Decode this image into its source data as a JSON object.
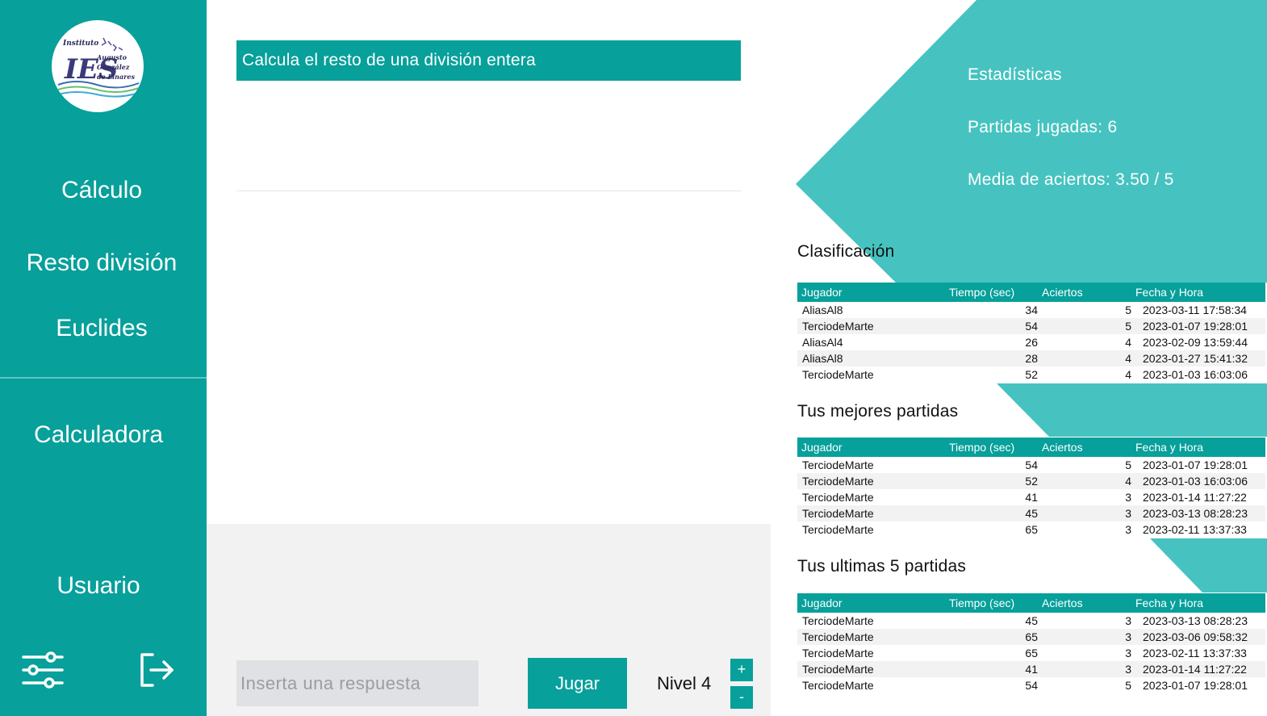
{
  "sidebar": {
    "logo_text": "Instituto IES Augusto González de Linares",
    "items": [
      {
        "label": "Cálculo"
      },
      {
        "label": "Resto división"
      },
      {
        "label": "Euclides"
      },
      {
        "label": "Calculadora"
      },
      {
        "label": "Usuario"
      }
    ],
    "icons": [
      "settings-sliders-icon",
      "logout-icon"
    ]
  },
  "main": {
    "question_title": "Calcula el resto de una división entera",
    "answer_placeholder": "Inserta una respuesta",
    "answer_value": "",
    "play_label": "Jugar",
    "level_label": "Nivel 4",
    "level_plus": "+",
    "level_minus": "-"
  },
  "stats": {
    "title": "Estadísticas",
    "games_played": "Partidas jugadas: 6",
    "average_hits": "Media de aciertos: 3.50 / 5"
  },
  "colors": {
    "primary": "#07a09b",
    "decor": "#46c3c0",
    "divider": "#5cc6c2",
    "panel_grey": "#f2f2f2",
    "input_grey": "#dfe1e4"
  },
  "tables": [
    {
      "title": "Clasificación",
      "headers": [
        "Jugador",
        "Tiempo (sec)",
        "Aciertos",
        "Fecha y Hora"
      ],
      "rows": [
        [
          "AliasAl8",
          "34",
          "5",
          "2023-03-11 17:58:34"
        ],
        [
          "TerciodeMarte",
          "54",
          "5",
          "2023-01-07 19:28:01"
        ],
        [
          "AliasAl4",
          "26",
          "4",
          "2023-02-09 13:59:44"
        ],
        [
          "AliasAl8",
          "28",
          "4",
          "2023-01-27 15:41:32"
        ],
        [
          "TerciodeMarte",
          "52",
          "4",
          "2023-01-03 16:03:06"
        ]
      ]
    },
    {
      "title": "Tus mejores partidas",
      "headers": [
        "Jugador",
        "Tiempo (sec)",
        "Aciertos",
        "Fecha y Hora"
      ],
      "rows": [
        [
          "TerciodeMarte",
          "54",
          "5",
          "2023-01-07 19:28:01"
        ],
        [
          "TerciodeMarte",
          "52",
          "4",
          "2023-01-03 16:03:06"
        ],
        [
          "TerciodeMarte",
          "41",
          "3",
          "2023-01-14 11:27:22"
        ],
        [
          "TerciodeMarte",
          "45",
          "3",
          "2023-03-13 08:28:23"
        ],
        [
          "TerciodeMarte",
          "65",
          "3",
          "2023-02-11 13:37:33"
        ]
      ]
    },
    {
      "title": "Tus ultimas 5 partidas",
      "headers": [
        "Jugador",
        "Tiempo (sec)",
        "Aciertos",
        "Fecha y Hora"
      ],
      "rows": [
        [
          "TerciodeMarte",
          "45",
          "3",
          "2023-03-13 08:28:23"
        ],
        [
          "TerciodeMarte",
          "65",
          "3",
          "2023-03-06 09:58:32"
        ],
        [
          "TerciodeMarte",
          "65",
          "3",
          "2023-02-11 13:37:33"
        ],
        [
          "TerciodeMarte",
          "41",
          "3",
          "2023-01-14 11:27:22"
        ],
        [
          "TerciodeMarte",
          "54",
          "5",
          "2023-01-07 19:28:01"
        ]
      ]
    }
  ]
}
